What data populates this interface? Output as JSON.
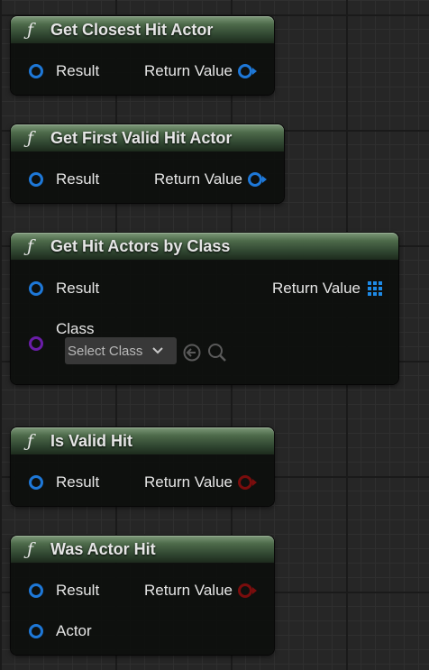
{
  "nodes": [
    {
      "title": "Get Closest Hit Actor",
      "input_pin": "Result",
      "output_pin": "Return Value"
    },
    {
      "title": "Get First Valid Hit Actor",
      "input_pin": "Result",
      "output_pin": "Return Value"
    },
    {
      "title": "Get Hit Actors by Class",
      "input_pin": "Result",
      "output_pin": "Return Value",
      "class_pin": "Class",
      "class_select": "Select Class"
    },
    {
      "title": "Is Valid Hit",
      "input_pin": "Result",
      "output_pin": "Return Value"
    },
    {
      "title": "Was Actor Hit",
      "input_pin": "Result",
      "output_pin": "Return Value",
      "actor_pin": "Actor"
    }
  ],
  "function_glyph": "ƒ",
  "pin_colors": {
    "struct": "#1e78d8",
    "boolean": "#7a0d0d",
    "class": "#6a1da8",
    "object_array": "#1e8ae6"
  }
}
